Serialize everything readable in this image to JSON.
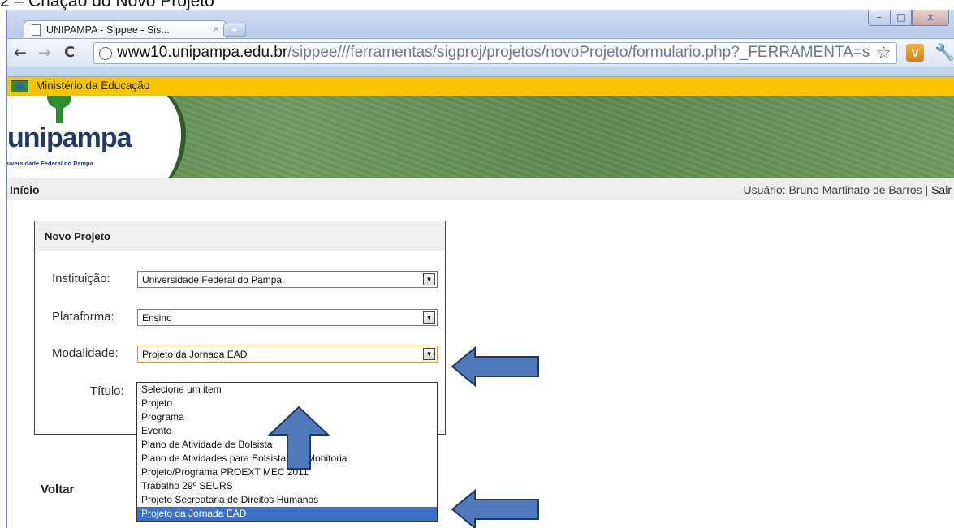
{
  "caption": "2 – Criação do Novo Projeto",
  "browser": {
    "tab_title": "UNIPAMPA - Sippee - Sis...",
    "tab_close": "×",
    "new_tab": "+",
    "url_host": "www10.unipampa.edu.br",
    "url_path": "/sippee///ferramentas/sigproj/projetos/novoProjeto/formulario.php?_FERRAMENTA=s",
    "window_controls": {
      "minimize": "–",
      "maximize": "□",
      "close": "x"
    },
    "nav": {
      "back": "←",
      "forward": "→",
      "reload": "C"
    }
  },
  "site": {
    "gov_label": "Ministério da Educação",
    "logo_text": "unipampa",
    "logo_subtitle": "Universidade Federal do Pampa",
    "home_link": "Início",
    "user_label": "Usuário: Bruno Martinato de Barros",
    "separator": " | ",
    "logout": "Sair"
  },
  "form": {
    "title": "Novo Projeto",
    "fields": {
      "instituicao": {
        "label": "Instituição:",
        "value": "Universidade Federal do Pampa"
      },
      "plataforma": {
        "label": "Plataforma:",
        "value": "Ensino"
      },
      "modalidade": {
        "label": "Modalidade:",
        "value": "Projeto da Jornada EAD"
      },
      "titulo": {
        "label": "Título:"
      }
    },
    "modalidade_options": [
      "Selecione um item",
      "Projeto",
      "Programa",
      "Evento",
      "Plano de Atividade de Bolsista",
      "Plano de Atividades para Bolsistas de Monitoria",
      "Projeto/Programa PROEXT MEC 2011",
      "Trabalho 29º SEURS",
      "Projeto Secreataria de Direitos Humanos",
      "Projeto da Jornada EAD"
    ],
    "selected_index": 9,
    "back": "Voltar"
  },
  "colors": {
    "gov_bar": "#f7c600",
    "selection": "#3a70c8",
    "annotation_arrow": "#4f79b8"
  }
}
